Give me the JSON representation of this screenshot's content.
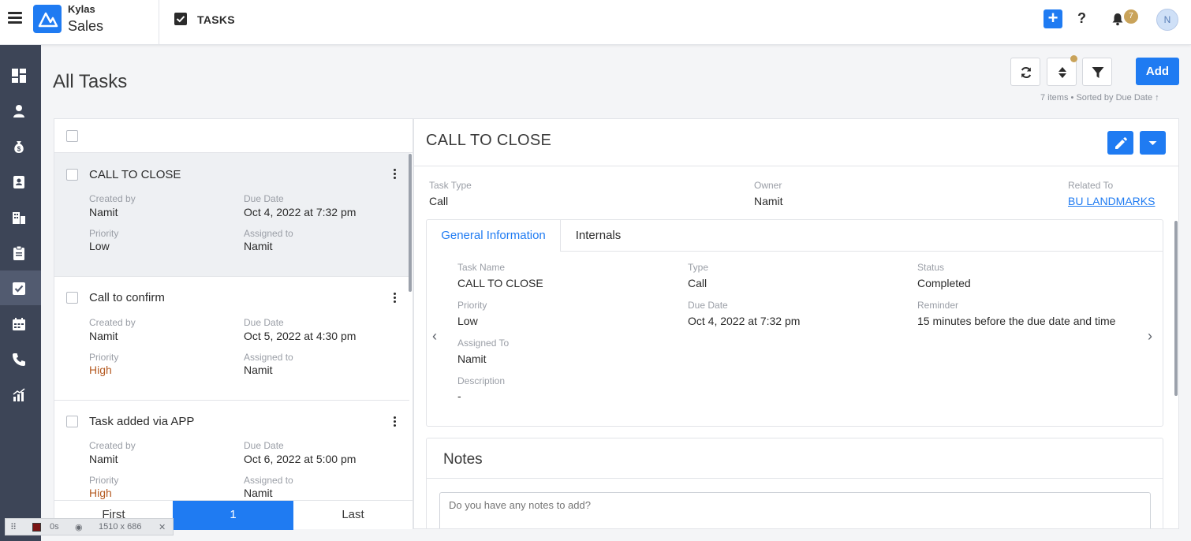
{
  "app": {
    "brand_line1": "Kylas",
    "brand_line2": "Sales",
    "module_title": "TASKS",
    "notification_count": "7",
    "avatar_initial": "N"
  },
  "sidebar": {
    "items": [
      "dashboard-icon",
      "user-icon",
      "money-bag-icon",
      "contact-icon",
      "building-icon",
      "clipboard-icon",
      "tasks-icon",
      "calendar-icon",
      "phone-icon",
      "reports-icon"
    ],
    "active_index": 6
  },
  "page": {
    "title": "All Tasks",
    "add_label": "Add",
    "items_count": "7 items",
    "sorted_by_label": "Sorted by",
    "sorted_field": "Due Date"
  },
  "tasks": [
    {
      "title": "CALL TO CLOSE",
      "created_by_label": "Created by",
      "created_by": "Namit",
      "due_label": "Due Date",
      "due": "Oct 4, 2022 at 7:32 pm",
      "priority_label": "Priority",
      "priority": "Low",
      "assigned_label": "Assigned to",
      "assigned": "Namit"
    },
    {
      "title": "Call to confirm",
      "created_by_label": "Created by",
      "created_by": "Namit",
      "due_label": "Due Date",
      "due": "Oct 5, 2022 at 4:30 pm",
      "priority_label": "Priority",
      "priority": "High",
      "assigned_label": "Assigned to",
      "assigned": "Namit"
    },
    {
      "title": "Task added via APP",
      "created_by_label": "Created by",
      "created_by": "Namit",
      "due_label": "Due Date",
      "due": "Oct 6, 2022 at 5:00 pm",
      "priority_label": "Priority",
      "priority": "High",
      "assigned_label": "Assigned to",
      "assigned": "Namit"
    }
  ],
  "pager": {
    "first": "First",
    "current": "1",
    "last": "Last"
  },
  "detail": {
    "title": "CALL TO CLOSE",
    "task_type_label": "Task Type",
    "task_type": "Call",
    "owner_label": "Owner",
    "owner": "Namit",
    "related_label": "Related To",
    "related": "BU LANDMARKS",
    "tabs": [
      "General Information",
      "Internals"
    ],
    "fields": {
      "task_name_label": "Task Name",
      "task_name": "CALL TO CLOSE",
      "type_label": "Type",
      "type": "Call",
      "status_label": "Status",
      "status": "Completed",
      "priority_label": "Priority",
      "priority": "Low",
      "due_label": "Due Date",
      "due": "Oct 4, 2022 at 7:32 pm",
      "reminder_label": "Reminder",
      "reminder": "15 minutes before the due date and time",
      "assigned_label": "Assigned To",
      "assigned": "Namit",
      "description_label": "Description",
      "description": "-"
    },
    "notes_title": "Notes",
    "notes_placeholder": "Do you have any notes to add?"
  },
  "recorder": {
    "time": "0s",
    "size": "1510 x 686"
  },
  "colors": {
    "accent": "#1f7bf2",
    "sidebar": "#3d4557",
    "high_priority": "#b55b22",
    "badge": "#c9a35a"
  }
}
